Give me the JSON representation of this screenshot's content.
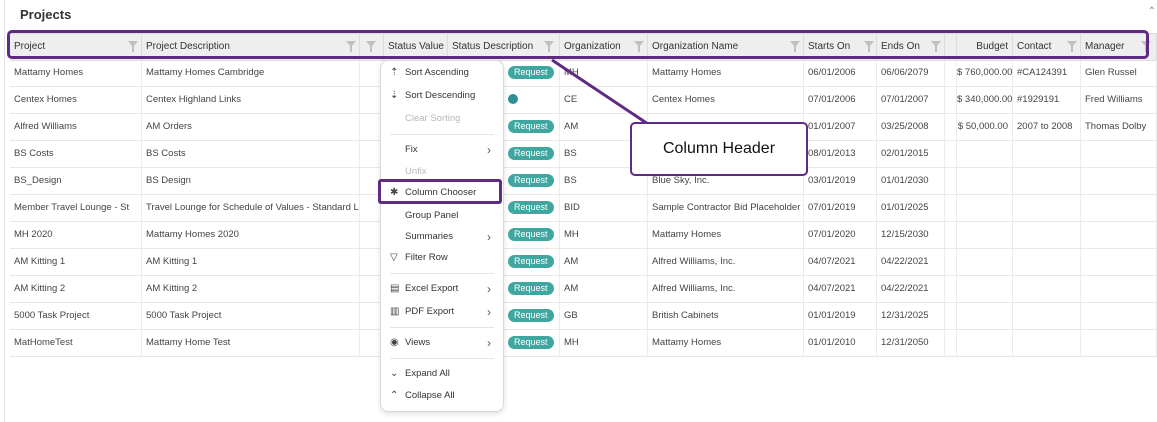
{
  "panel": {
    "title": "Projects"
  },
  "columns": [
    {
      "label": "Project"
    },
    {
      "label": "Project Description"
    },
    {
      "label": ""
    },
    {
      "label": "Status Value"
    },
    {
      "label": "Status Description"
    },
    {
      "label": "Organization"
    },
    {
      "label": "Organization Name"
    },
    {
      "label": "Starts On"
    },
    {
      "label": "Ends On"
    },
    {
      "label": ""
    },
    {
      "label": "Budget"
    },
    {
      "label": "Contact"
    },
    {
      "label": "Manager"
    }
  ],
  "badge_label": "Request",
  "rows": [
    {
      "project": "Mattamy Homes",
      "description": "Mattamy Homes Cambridge",
      "org": "MH",
      "org_name": "Mattamy Homes",
      "starts": "06/01/2006",
      "ends": "06/06/2079",
      "budget": "$ 760,000.00",
      "contact": "#CA124391",
      "manager": "Glen Russel"
    },
    {
      "project": "Centex Homes",
      "description": "Centex Highland Links",
      "org": "CE",
      "org_name": "Centex Homes",
      "starts": "07/01/2006",
      "ends": "07/01/2007",
      "budget": "$ 340,000.00",
      "contact": "#1929191",
      "manager": "Fred Williams"
    },
    {
      "project": "Alfred Williams",
      "description": "AM Orders",
      "org": "AM",
      "org_name": "",
      "starts": "01/01/2007",
      "ends": "03/25/2008",
      "budget": "$ 50,000.00",
      "contact": "2007 to 2008",
      "manager": "Thomas Dolby"
    },
    {
      "project": "BS Costs",
      "description": "BS Costs",
      "org": "BS",
      "org_name": "",
      "starts": "08/01/2013",
      "ends": "02/01/2015",
      "budget": "",
      "contact": "",
      "manager": ""
    },
    {
      "project": "BS_Design",
      "description": "BS Design",
      "org": "BS",
      "org_name": "Blue Sky, Inc.",
      "starts": "03/01/2019",
      "ends": "01/01/2030",
      "budget": "",
      "contact": "",
      "manager": ""
    },
    {
      "project": "Member Travel Lounge - St",
      "description": "Travel Lounge for Schedule of Values - Standard La",
      "org": "BID",
      "org_name": "Sample Contractor Bid Placeholder",
      "starts": "07/01/2019",
      "ends": "01/01/2025",
      "budget": "",
      "contact": "",
      "manager": ""
    },
    {
      "project": "MH 2020",
      "description": "Mattamy Homes 2020",
      "org": "MH",
      "org_name": "Mattamy Homes",
      "starts": "07/01/2020",
      "ends": "12/15/2030",
      "budget": "",
      "contact": "",
      "manager": ""
    },
    {
      "project": "AM Kitting 1",
      "description": "AM Kitting 1",
      "org": "AM",
      "org_name": "Alfred Williams, Inc.",
      "starts": "04/07/2021",
      "ends": "04/22/2021",
      "budget": "",
      "contact": "",
      "manager": ""
    },
    {
      "project": "AM Kitting 2",
      "description": "AM Kitting 2",
      "org": "AM",
      "org_name": "Alfred Williams, Inc.",
      "starts": "04/07/2021",
      "ends": "04/22/2021",
      "budget": "",
      "contact": "",
      "manager": ""
    },
    {
      "project": "5000 Task Project",
      "description": "5000 Task Project",
      "org": "GB",
      "org_name": "British Cabinets",
      "starts": "01/01/2019",
      "ends": "12/31/2025",
      "budget": "",
      "contact": "",
      "manager": ""
    },
    {
      "project": "MatHomeTest",
      "description": "Mattamy Home Test",
      "org": "MH",
      "org_name": "Mattamy Homes",
      "starts": "01/01/2010",
      "ends": "12/31/2050",
      "budget": "",
      "contact": "",
      "manager": ""
    }
  ],
  "menu": {
    "sort_ascending": "Sort Ascending",
    "sort_descending": "Sort Descending",
    "clear_sorting": "Clear Sorting",
    "fix": "Fix",
    "unfix": "Unfix",
    "column_chooser": "Column Chooser",
    "group_panel": "Group Panel",
    "summaries": "Summaries",
    "filter_row": "Filter Row",
    "excel_export": "Excel Export",
    "pdf_export": "PDF Export",
    "views": "Views",
    "expand_all": "Expand All",
    "collapse_all": "Collapse All"
  },
  "callout": {
    "text": "Column Header"
  },
  "colors": {
    "highlight": "#5f2a84",
    "badge": "#3fa7a0",
    "header_bg": "#eeeeee"
  },
  "icons": [
    "filter-icon",
    "sort-ascending-icon",
    "sort-descending-icon",
    "chevron-right-icon",
    "asterisk-icon",
    "funnel-icon",
    "excel-icon",
    "pdf-icon",
    "eye-icon",
    "expand-all-icon",
    "collapse-all-icon"
  ]
}
